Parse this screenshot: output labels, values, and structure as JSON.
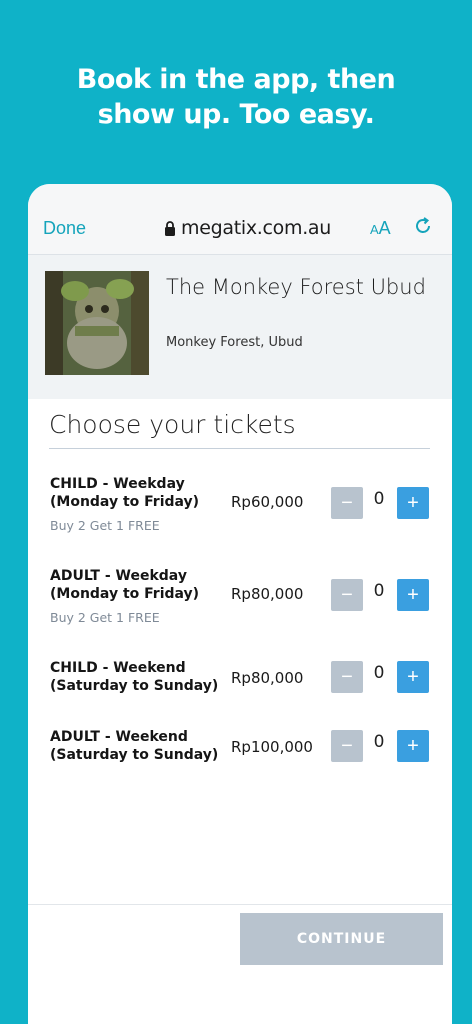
{
  "headline": {
    "line1": "Book in the app, then",
    "line2": "show up. Too easy."
  },
  "browser": {
    "done_label": "Done",
    "url": "megatix.com.au",
    "text_size_label_small": "A",
    "text_size_label_large": "A",
    "icons": [
      "lock-icon",
      "reload-icon"
    ]
  },
  "event": {
    "title": "The Monkey Forest Ubud",
    "location": "Monkey Forest, Ubud"
  },
  "tickets_section": {
    "title": "Choose your tickets",
    "tickets": [
      {
        "name": "CHILD - Weekday (Monday to Friday)",
        "promo": "Buy 2 Get 1 FREE",
        "price": "Rp60,000",
        "qty": "0"
      },
      {
        "name": "ADULT - Weekday (Monday to Friday)",
        "promo": "Buy 2 Get 1 FREE",
        "price": "Rp80,000",
        "qty": "0"
      },
      {
        "name": "CHILD - Weekend (Saturday to Sunday)",
        "promo": "",
        "price": "Rp80,000",
        "qty": "0"
      },
      {
        "name": "ADULT - Weekend (Saturday to Sunday)",
        "promo": "",
        "price": "Rp100,000",
        "qty": "0"
      }
    ],
    "minus_label": "−",
    "plus_label": "+"
  },
  "continue_label": "CONTINUE",
  "colors": {
    "background": "#0fb2c8",
    "accent": "#15a4bb",
    "plus_button": "#3a9fe0",
    "disabled": "#b8c3ce"
  }
}
